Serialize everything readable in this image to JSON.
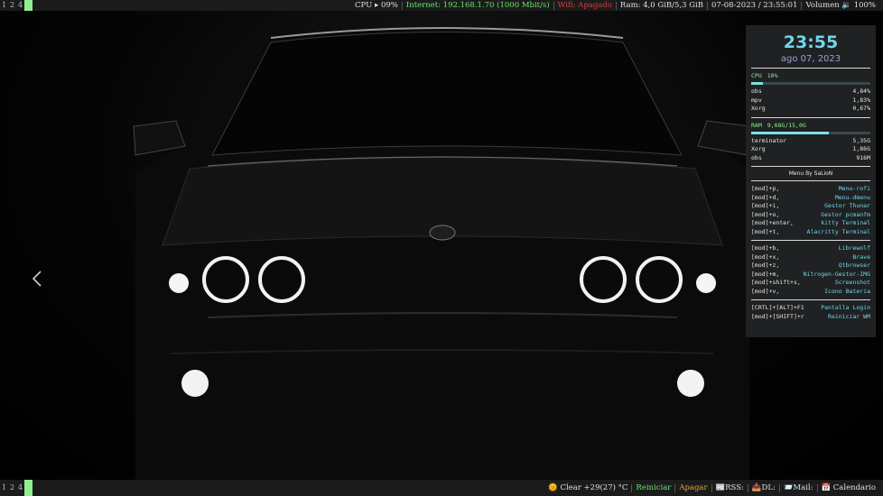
{
  "top_bar": {
    "tags": [
      "1",
      "2",
      "4",
      ""
    ],
    "cpu": "CPU ▸ 09%",
    "internet": "Internet: 192.168.1.70 (1000 Mbit/s)",
    "wifi": "Wifi: Apagado",
    "ram": "Ram: 4,0 GiB/5,3 GiB",
    "datetime": "07-08-2023  / 23:55:01",
    "volume": "Volumen 🔉 100%"
  },
  "bottom_bar": {
    "tags": [
      "1",
      "2",
      "4",
      ""
    ],
    "weather": "🌞 Clear +29(27) °C",
    "restart": "Reiniciar",
    "shutdown": "Apagar",
    "rss": "📰RSS:",
    "dl": "📥DL:",
    "mail": "📨Mail:",
    "calendar": "📅 Calendario"
  },
  "conky": {
    "clock": "23:55",
    "date": "ago 07, 2023",
    "cpu_label": "CPU",
    "cpu_value": "10%",
    "cpu_fraction": 0.1,
    "cpu_procs": [
      {
        "name": "obs",
        "value": "4,84%"
      },
      {
        "name": "mpv",
        "value": "1,83%"
      },
      {
        "name": "Xorg",
        "value": "0,67%"
      }
    ],
    "ram_label": "RAM",
    "ram_value": "9,68G/15,0G",
    "ram_fraction": 0.65,
    "ram_procs": [
      {
        "name": "terminator",
        "value": "5,35G"
      },
      {
        "name": "Xorg",
        "value": "1,86G"
      },
      {
        "name": "obs",
        "value": "916M"
      }
    ],
    "menu_title": "Menu By SaLioN",
    "menu_groups": [
      [
        {
          "key": "[mod]+p,",
          "action": "Menu-rofi"
        },
        {
          "key": "[mod]+d,",
          "action": "Menu-dmenu"
        },
        {
          "key": "[mod]+i,",
          "action": "Gestor Thunar"
        },
        {
          "key": "[mod]+o,",
          "action": "Gestor pcmanfm"
        },
        {
          "key": "[mod]+enter,",
          "action": "kitty Terminal"
        },
        {
          "key": "[mod]+t,",
          "action": "Alacritty Terminal"
        }
      ],
      [
        {
          "key": "[mod]+b,",
          "action": "Librewolf"
        },
        {
          "key": "[mod]+x,",
          "action": "Brave"
        },
        {
          "key": "[mod]+z,",
          "action": "Qtbrowser"
        },
        {
          "key": "[mod]+m,",
          "action": "Nitrogen-Gestor-IMG"
        },
        {
          "key": "[mod]+shift+s,",
          "action": "Screenshot"
        },
        {
          "key": "[mod]+v,",
          "action": "Icono Bateria"
        }
      ],
      [
        {
          "key": "[CRTL]+[ALT]+F1",
          "action": "Pantalla Login"
        },
        {
          "key": "[mod]+[SHIFT]+r",
          "action": "Reiniciar WM"
        }
      ]
    ]
  },
  "icons": {
    "prev_arrow": "chevron-left-icon"
  },
  "colors": {
    "accent_cyan": "#6fd7e8",
    "tag_active": "#8fef8f",
    "bar_bg": "#1b1b1b",
    "panel_bg": "#222426"
  }
}
